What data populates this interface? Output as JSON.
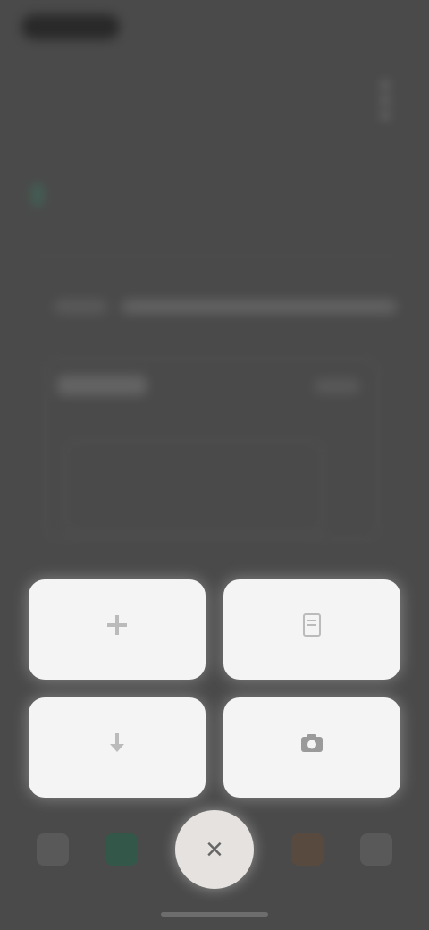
{
  "overlay": {
    "actions": [
      {
        "id": "a1",
        "label": "",
        "icon": "plus-icon"
      },
      {
        "id": "a2",
        "label": "",
        "icon": "document-icon"
      },
      {
        "id": "a3",
        "label": "",
        "icon": "download-icon"
      },
      {
        "id": "a4",
        "label": "",
        "icon": "camera-icon"
      }
    ],
    "fab_icon": "close-icon",
    "fab_symbol": "×"
  },
  "colors": {
    "background": "#4a4a4a",
    "tile": "#f4f4f4",
    "fab": "#e6e2df",
    "nav_active": "#2f5b49"
  }
}
